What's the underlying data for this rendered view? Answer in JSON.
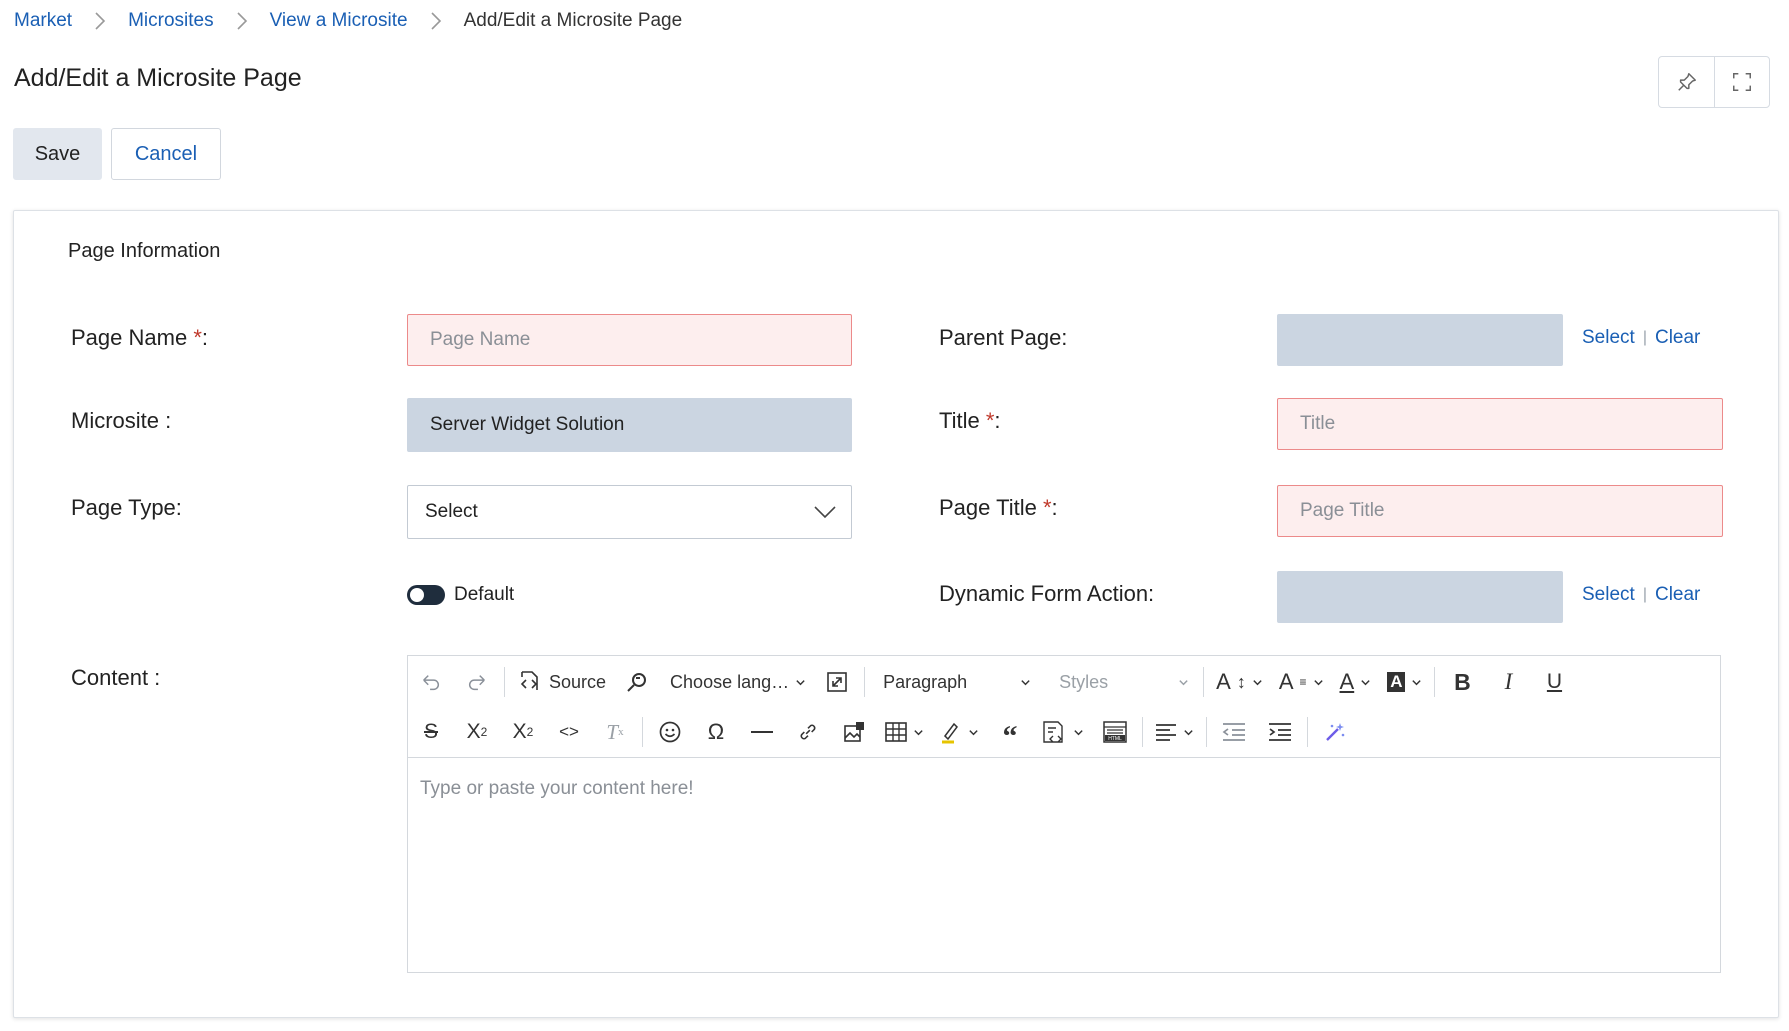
{
  "breadcrumb": {
    "items": [
      "Market",
      "Microsites",
      "View a Microsite"
    ],
    "current": "Add/Edit a Microsite Page"
  },
  "page": {
    "title": "Add/Edit a Microsite Page"
  },
  "top_tools": {
    "pin_icon": "pin-icon",
    "fullscreen_icon": "fullscreen-icon"
  },
  "actions": {
    "save": "Save",
    "cancel": "Cancel"
  },
  "section": {
    "title": "Page Information"
  },
  "form": {
    "page_name": {
      "label": "Page Name",
      "required": "*",
      "suffix": ":",
      "placeholder": "Page Name"
    },
    "microsite": {
      "label": "Microsite :",
      "value": "Server Widget Solution"
    },
    "page_type": {
      "label": "Page Type:",
      "value": "Select"
    },
    "default_toggle": {
      "label": "Default",
      "on": false
    },
    "content": {
      "label": "Content :"
    },
    "parent_page": {
      "label": "Parent Page:",
      "select": "Select",
      "clear": "Clear"
    },
    "title": {
      "label": "Title ",
      "required": "*",
      "suffix": ":",
      "placeholder": "Title"
    },
    "page_title": {
      "label": "Page Title ",
      "required": "*",
      "suffix": ":",
      "placeholder": "Page Title"
    },
    "dynamic_form_action": {
      "label": "Dynamic Form Action:",
      "select": "Select",
      "clear": "Clear"
    }
  },
  "editor": {
    "source_label": "Source",
    "language_label": "Choose lang…",
    "paragraph_label": "Paragraph",
    "styles_label": "Styles",
    "placeholder": "Type or paste your content here!"
  },
  "colors": {
    "link": "#1a5fb4",
    "error_bg": "#fdeeee",
    "error_border": "#ec8a8a",
    "readonly_bg": "#cbd5e1",
    "required": "#c0392b"
  }
}
